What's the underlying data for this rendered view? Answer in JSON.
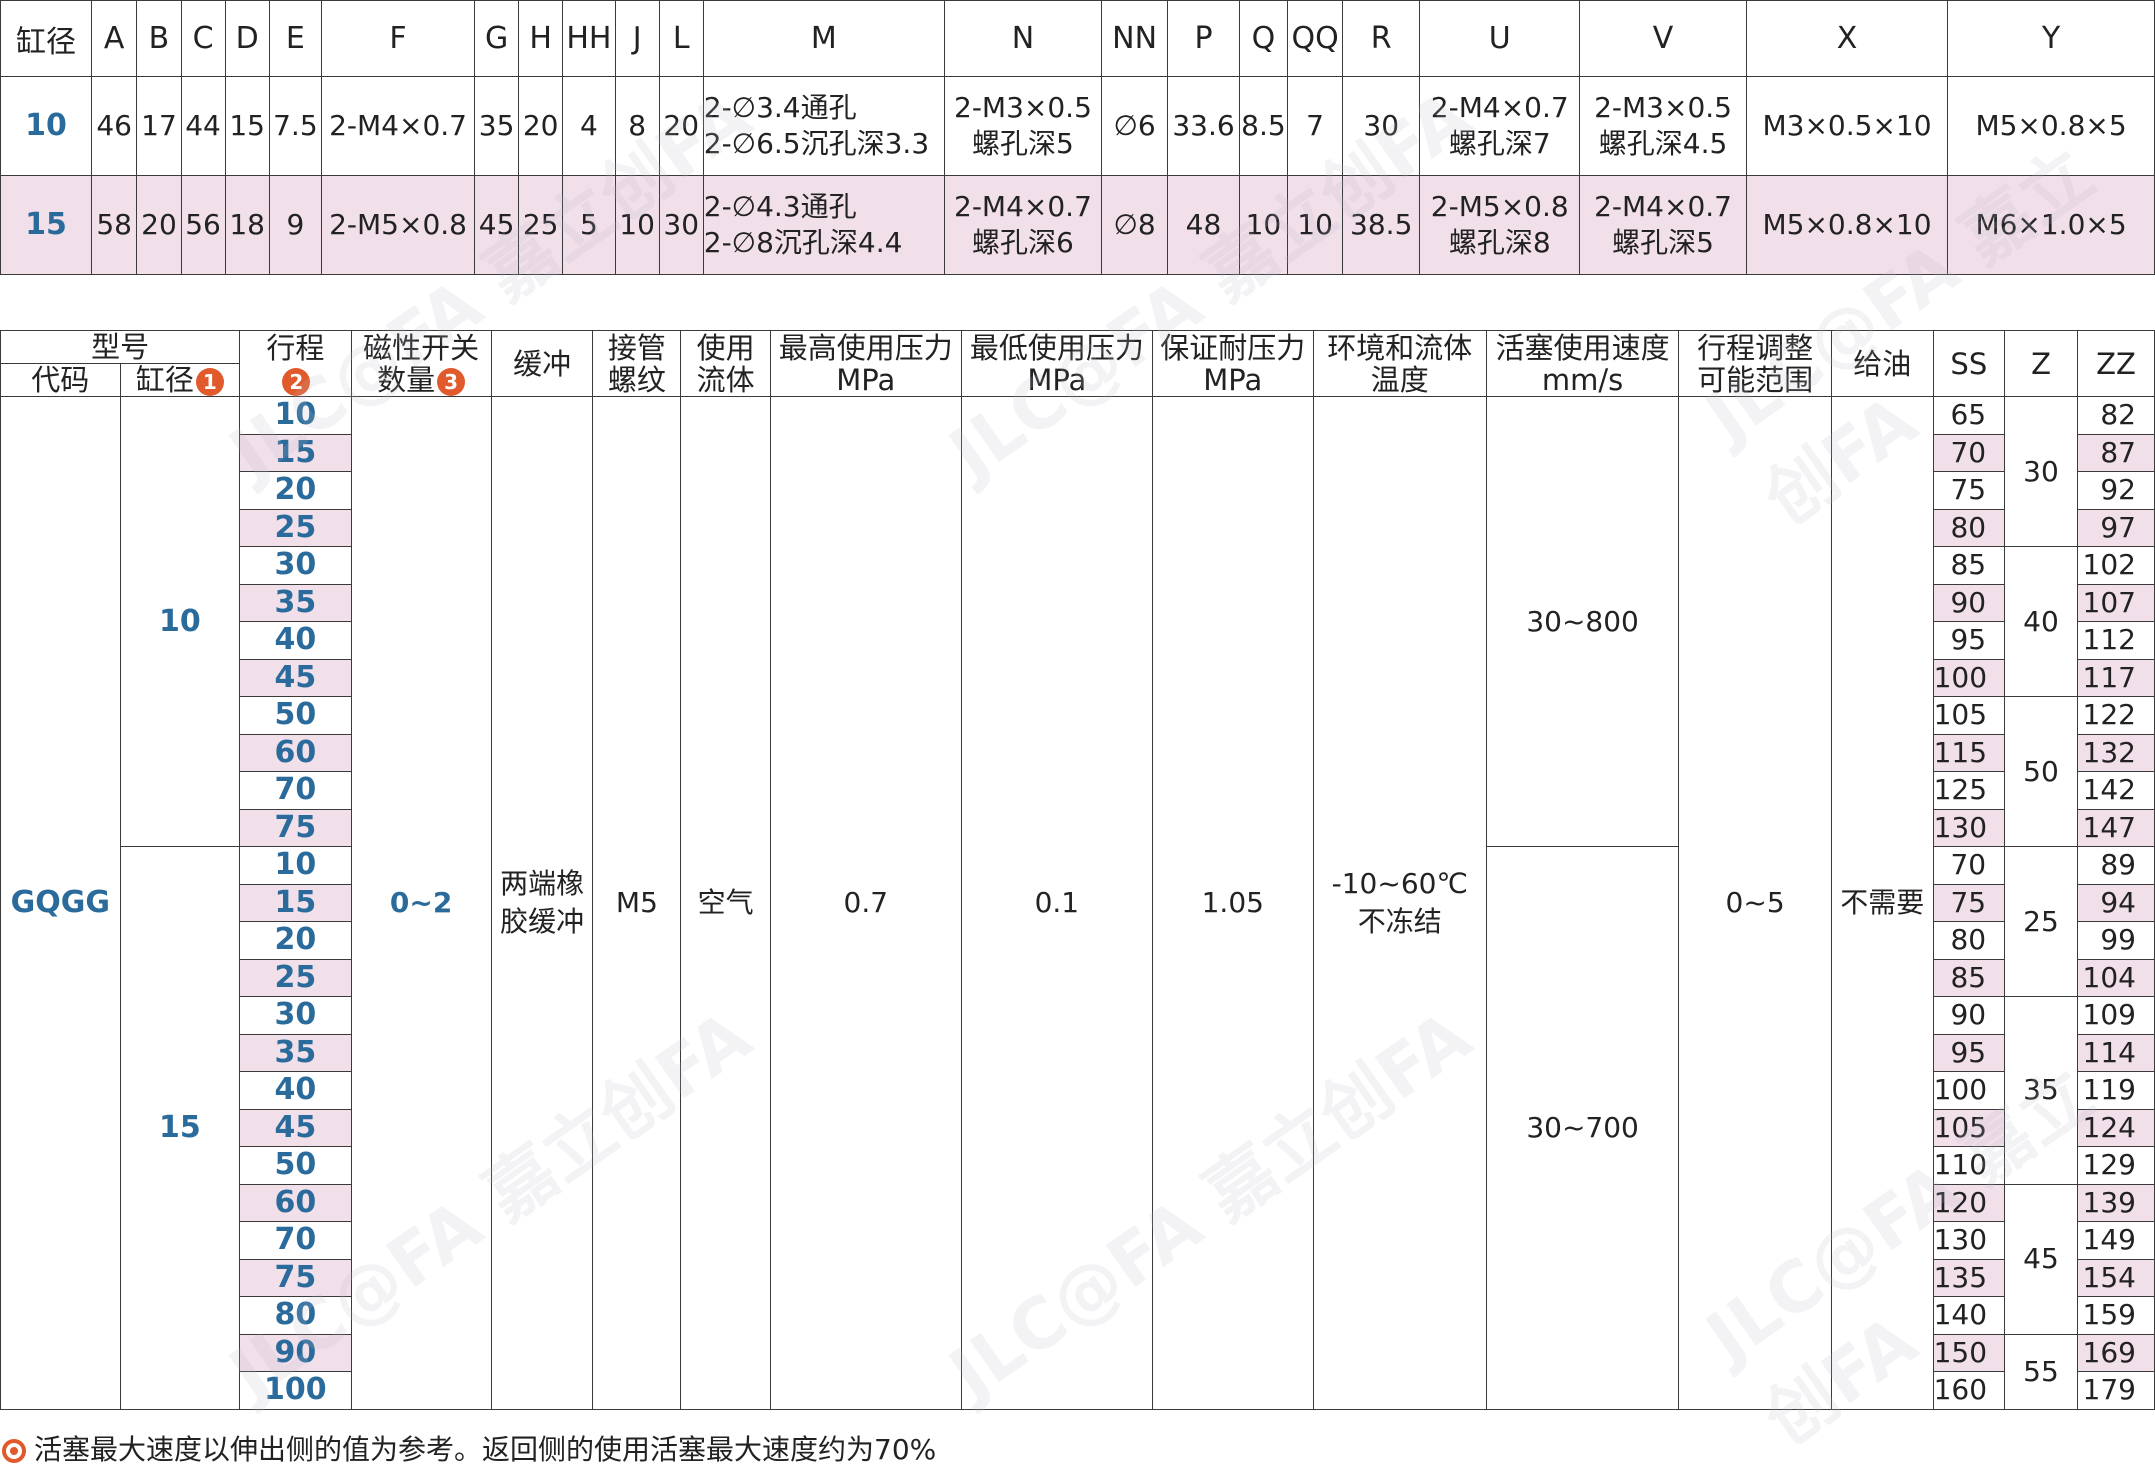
{
  "dims": {
    "headers": [
      "缸径",
      "A",
      "B",
      "C",
      "D",
      "E",
      "F",
      "G",
      "H",
      "HH",
      "J",
      "L",
      "M",
      "N",
      "NN",
      "P",
      "Q",
      "QQ",
      "R",
      "U",
      "V",
      "X",
      "Y"
    ],
    "rows": [
      {
        "bore": "10",
        "A": "46",
        "B": "17",
        "C": "44",
        "D": "15",
        "E": "7.5",
        "F": "2-M4×0.7",
        "G": "35",
        "H": "20",
        "HH": "4",
        "J": "8",
        "L": "20",
        "M1": "2-∅3.4通孔",
        "M2": "2-∅6.5沉孔深3.3",
        "N1": "2-M3×0.5",
        "N2": "螺孔深5",
        "NN": "∅6",
        "P": "33.6",
        "Q": "8.5",
        "QQ": "7",
        "R": "30",
        "U1": "2-M4×0.7",
        "U2": "螺孔深7",
        "V1": "2-M3×0.5",
        "V2": "螺孔深4.5",
        "X": "M3×0.5×10",
        "Y": "M5×0.8×5"
      },
      {
        "bore": "15",
        "A": "58",
        "B": "20",
        "C": "56",
        "D": "18",
        "E": "9",
        "F": "2-M5×0.8",
        "G": "45",
        "H": "25",
        "HH": "5",
        "J": "10",
        "L": "30",
        "M1": "2-∅4.3通孔",
        "M2": "2-∅8沉孔深4.4",
        "N1": "2-M4×0.7",
        "N2": "螺孔深6",
        "NN": "∅8",
        "P": "48",
        "Q": "10",
        "QQ": "10",
        "R": "38.5",
        "U1": "2-M5×0.8",
        "U2": "螺孔深8",
        "V1": "2-M4×0.7",
        "V2": "螺孔深5",
        "X": "M5×0.8×10",
        "Y": "M6×1.0×5"
      }
    ]
  },
  "spec": {
    "headers": {
      "model": "型号",
      "code": "代码",
      "bore": "缸径",
      "bore_badge": "1",
      "stroke": "行程",
      "stroke_badge": "2",
      "switch_l1": "磁性开关",
      "switch_l2": "数量",
      "switch_badge": "3",
      "cushion": "缓冲",
      "port_l1": "接管",
      "port_l2": "螺纹",
      "fluid_l1": "使用",
      "fluid_l2": "流体",
      "pmax_l1": "最高使用压力",
      "pmax_l2": "MPa",
      "pmin_l1": "最低使用压力",
      "pmin_l2": "MPa",
      "proof_l1": "保证耐压力",
      "proof_l2": "MPa",
      "temp_l1": "环境和流体",
      "temp_l2": "温度",
      "speed_l1": "活塞使用速度",
      "speed_l2": "mm/s",
      "adjust_l1": "行程调整",
      "adjust_l2": "可能范围",
      "lube": "给油",
      "ss": "SS",
      "z": "Z",
      "zz": "ZZ"
    },
    "code": "GQGG",
    "bores": [
      "10",
      "15"
    ],
    "switch_qty": "0~2",
    "cushion_l1": "两端橡",
    "cushion_l2": "胶缓冲",
    "port": "M5",
    "fluid": "空气",
    "pmax": "0.7",
    "pmin": "0.1",
    "proof": "1.05",
    "temp_l1": "-10~60℃",
    "temp_l2": "不冻结",
    "speed": [
      "30~800",
      "30~700"
    ],
    "adjust": "0~5",
    "lube": "不需要",
    "rows10": [
      {
        "stroke": "10",
        "ss": "65",
        "zz": "82"
      },
      {
        "stroke": "15",
        "ss": "70",
        "zz": "87"
      },
      {
        "stroke": "20",
        "ss": "75",
        "zz": "92"
      },
      {
        "stroke": "25",
        "ss": "80",
        "zz": "97"
      },
      {
        "stroke": "30",
        "ss": "85",
        "zz": "102"
      },
      {
        "stroke": "35",
        "ss": "90",
        "zz": "107"
      },
      {
        "stroke": "40",
        "ss": "95",
        "zz": "112"
      },
      {
        "stroke": "45",
        "ss": "100",
        "zz": "117"
      },
      {
        "stroke": "50",
        "ss": "105",
        "zz": "122"
      },
      {
        "stroke": "60",
        "ss": "115",
        "zz": "132"
      },
      {
        "stroke": "70",
        "ss": "125",
        "zz": "142"
      },
      {
        "stroke": "75",
        "ss": "130",
        "zz": "147"
      }
    ],
    "rows15": [
      {
        "stroke": "10",
        "ss": "70",
        "zz": "89"
      },
      {
        "stroke": "15",
        "ss": "75",
        "zz": "94"
      },
      {
        "stroke": "20",
        "ss": "80",
        "zz": "99"
      },
      {
        "stroke": "25",
        "ss": "85",
        "zz": "104"
      },
      {
        "stroke": "30",
        "ss": "90",
        "zz": "109"
      },
      {
        "stroke": "35",
        "ss": "95",
        "zz": "114"
      },
      {
        "stroke": "40",
        "ss": "100",
        "zz": "119"
      },
      {
        "stroke": "45",
        "ss": "105",
        "zz": "124"
      },
      {
        "stroke": "50",
        "ss": "110",
        "zz": "129"
      },
      {
        "stroke": "60",
        "ss": "120",
        "zz": "139"
      },
      {
        "stroke": "70",
        "ss": "130",
        "zz": "149"
      },
      {
        "stroke": "75",
        "ss": "135",
        "zz": "154"
      },
      {
        "stroke": "80",
        "ss": "140",
        "zz": "159"
      },
      {
        "stroke": "90",
        "ss": "150",
        "zz": "169"
      },
      {
        "stroke": "100",
        "ss": "160",
        "zz": "179"
      }
    ],
    "z_groups": [
      {
        "value": "30",
        "rows": 4
      },
      {
        "value": "40",
        "rows": 4
      },
      {
        "value": "50",
        "rows": 4
      },
      {
        "value": "25",
        "rows": 4
      },
      {
        "value": "35",
        "rows": 5
      },
      {
        "value": "45",
        "rows": 4
      },
      {
        "value": "55",
        "rows": 2
      }
    ]
  },
  "footnote": "活塞最大速度以伸出侧的值为参考。返回侧的使用活塞最大速度约为70%",
  "watermark": "JLC@FA 嘉立创FA"
}
